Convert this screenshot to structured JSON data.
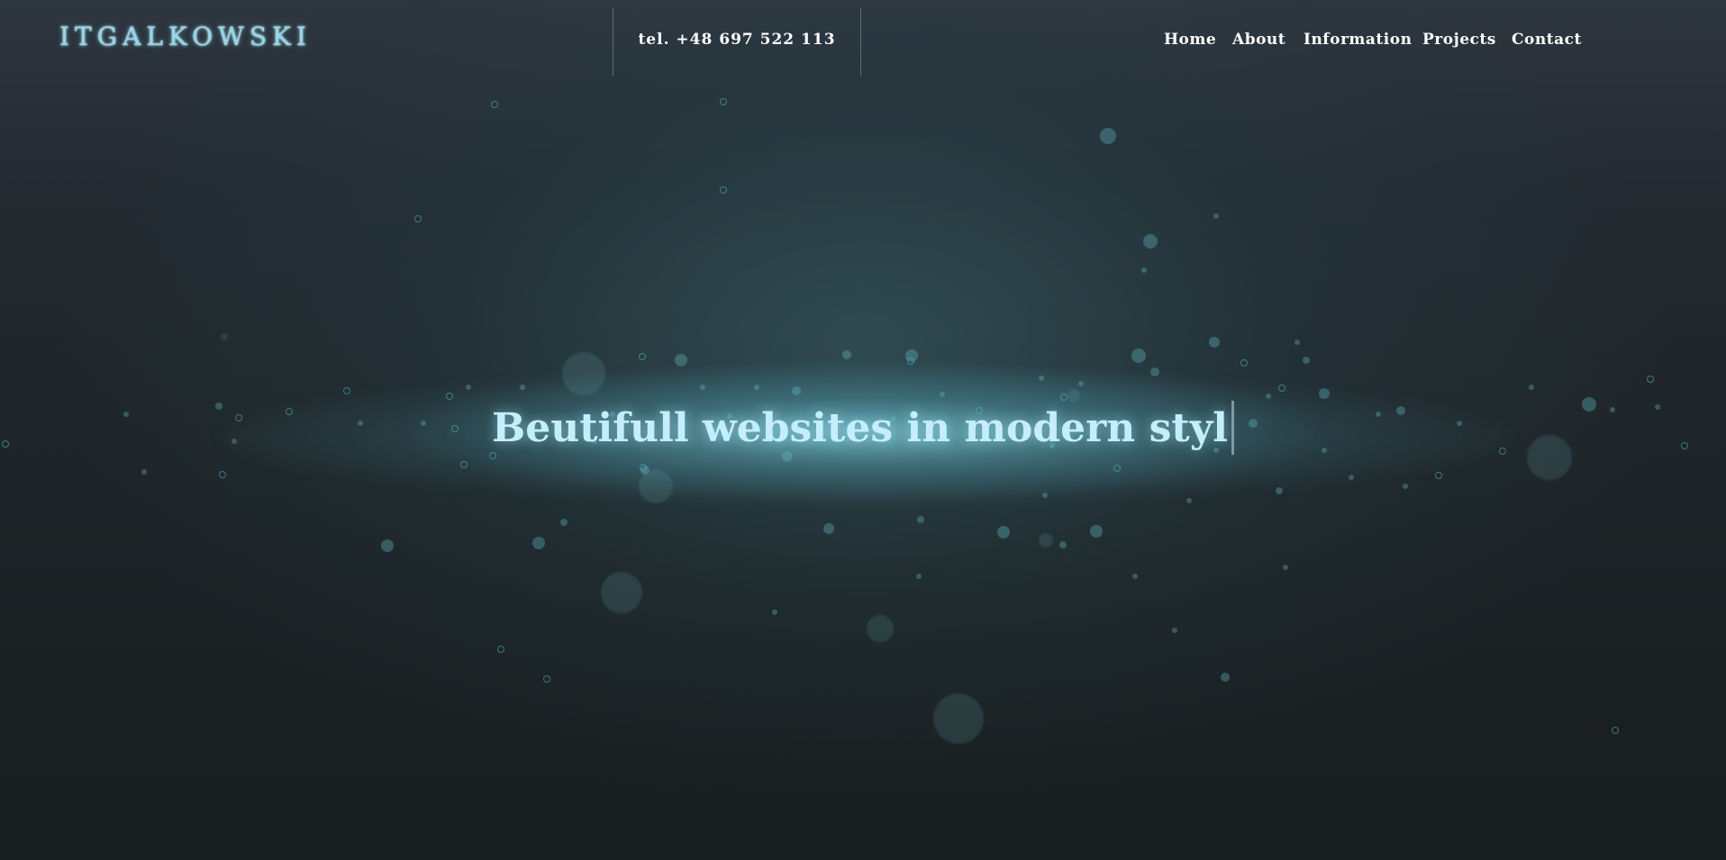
{
  "header": {
    "logo_text": "ITGALKOWSKI",
    "phone": "tel. +48 697 522 113"
  },
  "nav": {
    "items": [
      {
        "label": "Home"
      },
      {
        "label": "About"
      },
      {
        "label": "Information"
      },
      {
        "label": "Projects"
      },
      {
        "label": "Contact"
      }
    ]
  },
  "hero": {
    "typed_text": "Beutifull websites in modern styl"
  },
  "colors": {
    "accent": "#8fd8ee",
    "hero_text": "#c5eefb",
    "background": "#1a1f21"
  }
}
